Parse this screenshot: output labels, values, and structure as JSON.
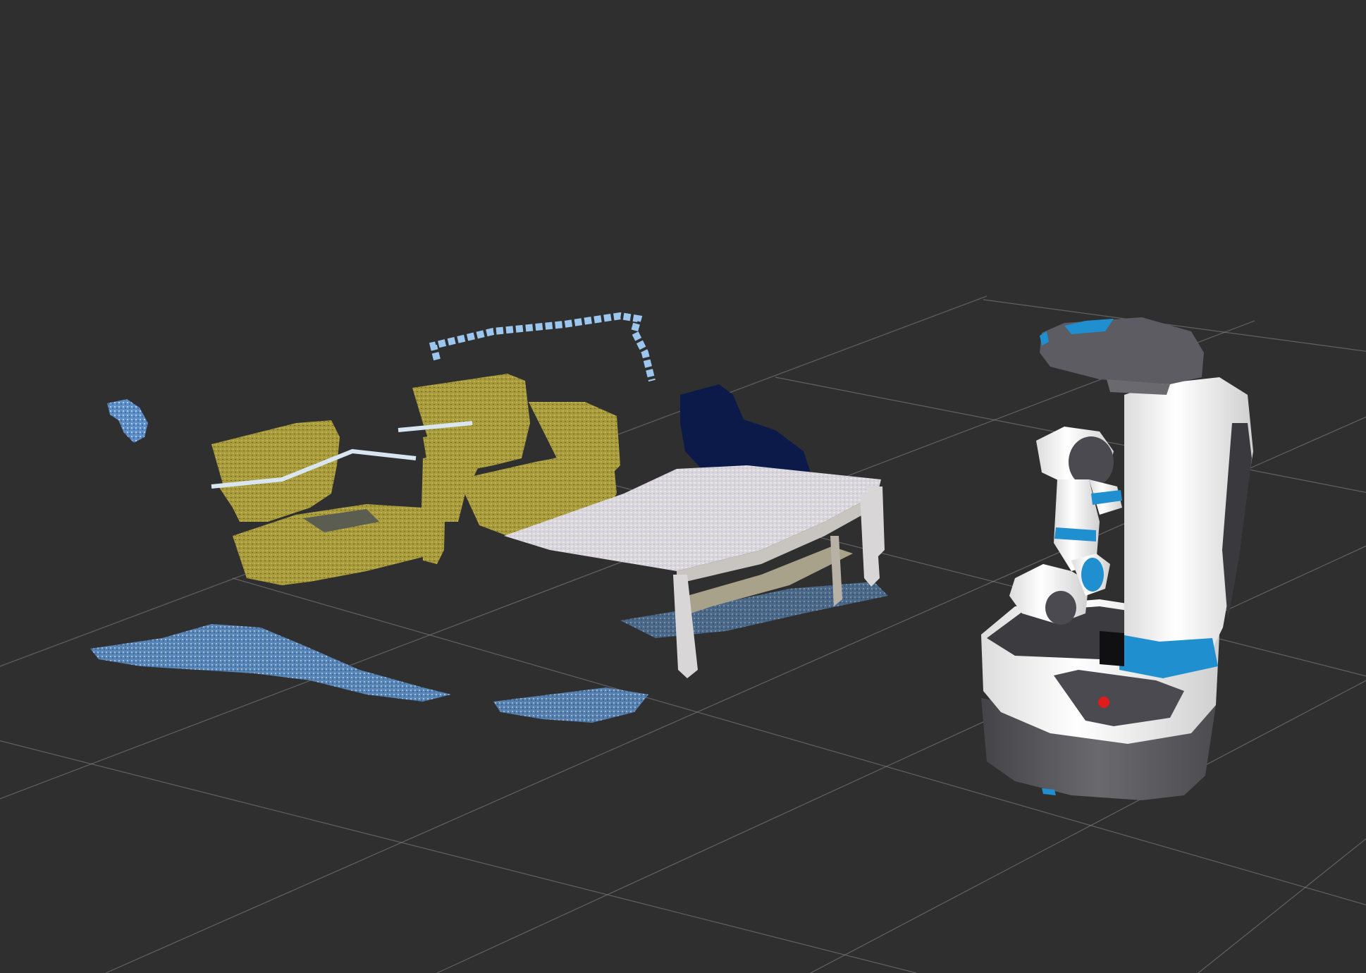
{
  "view": {
    "type": "3d-visualization",
    "background_color": "#2f2f2f",
    "grid": {
      "visible": true,
      "color": "#8a8a8a"
    }
  },
  "scene": {
    "objects": [
      {
        "name": "armchair",
        "kind": "point-cloud",
        "color": "#a89a3a"
      },
      {
        "name": "armchair",
        "kind": "point-cloud",
        "color": "#a89a3a"
      },
      {
        "name": "coffee-table",
        "kind": "point-cloud",
        "color": "#d9d6d8"
      },
      {
        "name": "dark-object",
        "kind": "point-cloud",
        "color": "#0c1a4a"
      },
      {
        "name": "floor-points",
        "kind": "point-cloud",
        "color": "#8fb8e8"
      }
    ],
    "robot": {
      "name": "mobile-manipulator-robot",
      "body_color": "#f4f4f4",
      "accent_color": "#1f8fd0",
      "base_color": "#5b5b5f",
      "indicator_color": "#e01b1b"
    }
  }
}
